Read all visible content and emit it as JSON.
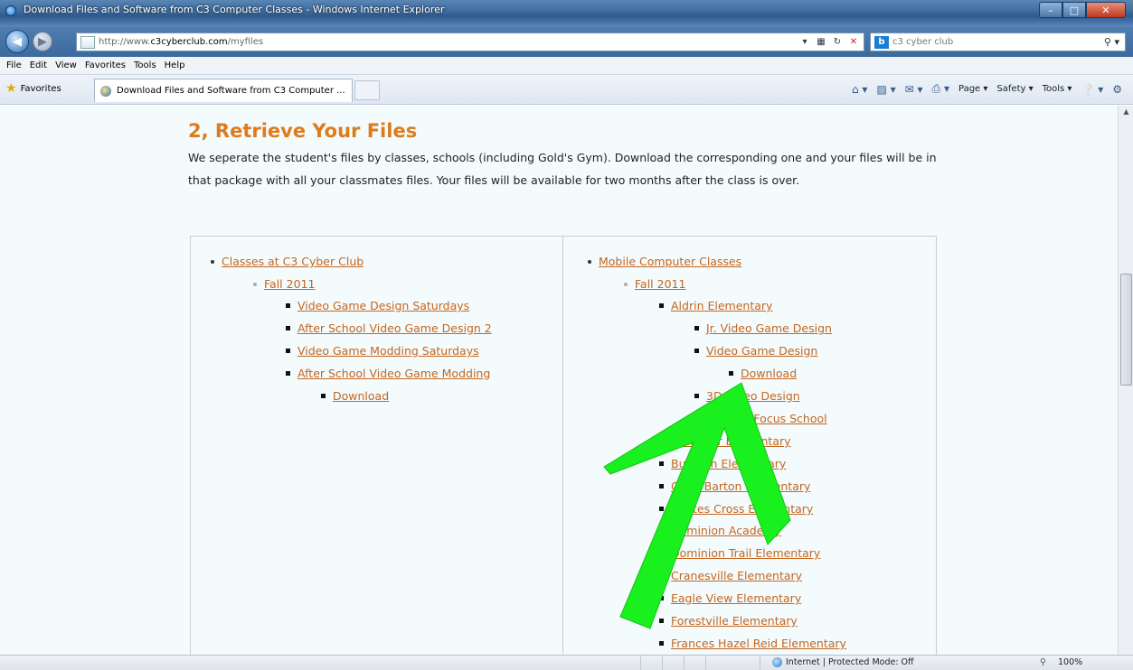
{
  "window": {
    "title": "Download Files and Software from C3 Computer Classes - Windows Internet Explorer"
  },
  "address": {
    "url_prefix": "http://www.",
    "url_domain": "c3cyberclub.com",
    "url_path": "/myfiles"
  },
  "search": {
    "query": "c3 cyber club"
  },
  "menu": [
    "File",
    "Edit",
    "View",
    "Favorites",
    "Tools",
    "Help"
  ],
  "favorites": {
    "label": "Favorites",
    "tab_title": "Download Files and Software from C3 Computer ..."
  },
  "command_bar": {
    "page": "Page ▾",
    "safety": "Safety ▾",
    "tools": "Tools ▾"
  },
  "page": {
    "heading": "2, Retrieve Your Files",
    "paragraph": "We seperate the student's files by classes, schools (including Gold's Gym). Download the corresponding one and your files will be in that package with all your classmates files. Your files will be available for two months after the class is over."
  },
  "left_list": {
    "root": "Classes at C3 Cyber Club",
    "term": "Fall 2011",
    "items": [
      "Video Game Design Saturdays",
      "After School Video Game Design 2",
      "Video Game Modding Saturdays",
      "After School Video Game Modding"
    ],
    "download": "Download"
  },
  "right_list": {
    "root": "Mobile Computer Classes",
    "term": "Fall 2011",
    "school": "Aldrin Elementary",
    "sub_items": [
      "Jr. Video Game Design",
      "Video Game Design"
    ],
    "download": "Download",
    "more_items": [
      "3D Video Design",
      "Science Focus School",
      "Bren Mar Elementary",
      "Bull Run Elementary",
      "Clara Barton Elementary",
      "Coates Cross Elementary",
      "Dominion Academy",
      "Dominion Trail Elementary",
      "Cranesville Elementary",
      "Eagle View Elementary",
      "Forestville Elementary",
      "Frances Hazel Reid Elementary"
    ]
  },
  "status": {
    "zone": "Internet | Protected Mode: Off",
    "zoom": "100%"
  },
  "colors": {
    "link": "#c4661e",
    "heading": "#dd7b1d",
    "arrow": "#19f01d"
  }
}
